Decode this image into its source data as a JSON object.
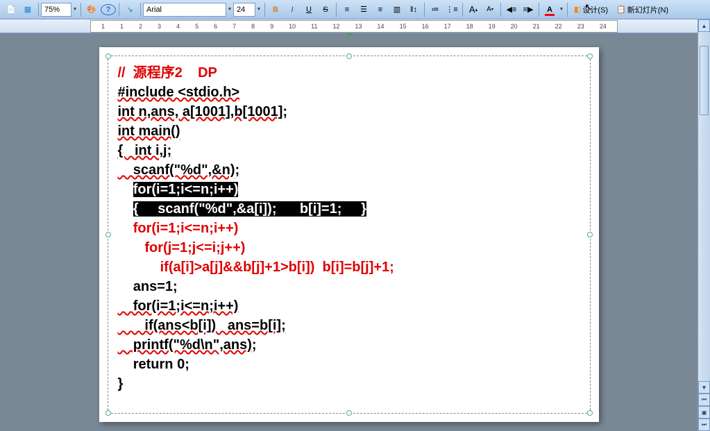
{
  "toolbar": {
    "zoom": "75%",
    "font_name": "Arial",
    "font_size": "24",
    "bold": "B",
    "italic": "I",
    "underline": "U",
    "strike": "S",
    "superscript": "A",
    "subscript": "A",
    "design": "设计(S)",
    "new_slide": "新幻灯片(N)"
  },
  "ruler": [
    "1",
    "1",
    "2",
    "3",
    "4",
    "5",
    "6",
    "7",
    "8",
    "9",
    "10",
    "11",
    "12",
    "13",
    "14",
    "15",
    "16",
    "17",
    "18",
    "19",
    "20",
    "21",
    "22",
    "23",
    "24"
  ],
  "code": {
    "l1": "//  源程序2    DP",
    "l2": "#include <stdio.h>",
    "l3": "int n,ans, a[1001],b[1001];",
    "l4": "int main()",
    "l5": "{   int i,j;",
    "l6": "    scanf(\"%d\",&n);",
    "l7a": "    ",
    "l7b": "for(i=1;i<=n;i++)",
    "l8a": "    ",
    "l8b": "{     scanf(\"%d\",&a[i]);      b[i]=1;     }",
    "l9": "    for(i=1;i<=n;i++)",
    "l10": "       for(j=1;j<=i;j++)",
    "l11": "           if(a[i]>a[j]&&b[j]+1>b[i])  b[i]=b[j]+1;",
    "l12": "    ans=1;",
    "l13": "    for(i=1;i<=n;i++)",
    "l14": "       if(ans<b[i])   ans=b[i];",
    "l15": "    printf(\"%d\\n\",ans);",
    "l16": "    return 0;",
    "l17": "}"
  }
}
